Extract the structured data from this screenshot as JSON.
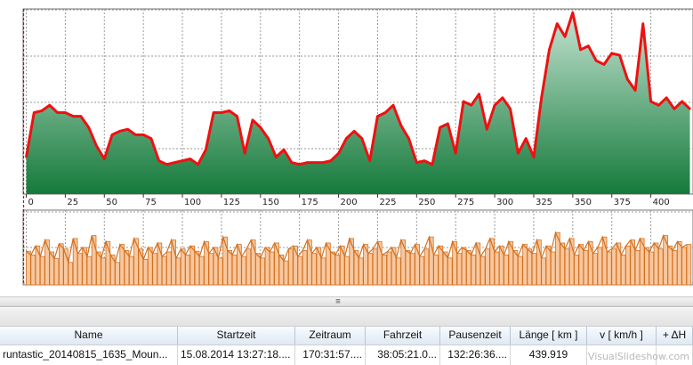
{
  "chart_data": [
    {
      "type": "area",
      "title": "",
      "xlabel": "",
      "ylabel": "",
      "xlim": [
        -2,
        427
      ],
      "ylim": [
        0,
        100
      ],
      "grid": true,
      "tick_labels": [
        "0",
        "25",
        "50",
        "75",
        "100",
        "125",
        "150",
        "175",
        "200",
        "225",
        "250",
        "275",
        "300",
        "325",
        "350",
        "375",
        "400"
      ],
      "x": [
        0,
        5,
        10,
        15,
        20,
        25,
        30,
        35,
        40,
        45,
        50,
        55,
        60,
        65,
        70,
        75,
        80,
        85,
        90,
        95,
        100,
        105,
        110,
        115,
        120,
        125,
        130,
        135,
        140,
        145,
        150,
        155,
        160,
        165,
        170,
        175,
        180,
        185,
        190,
        195,
        200,
        205,
        210,
        215,
        220,
        225,
        230,
        235,
        240,
        245,
        250,
        255,
        260,
        265,
        270,
        275,
        280,
        285,
        290,
        295,
        300,
        305,
        310,
        315,
        320,
        325,
        330,
        335,
        340,
        345,
        350,
        355,
        360,
        365,
        370,
        375,
        380,
        385,
        390,
        395,
        400,
        405,
        410,
        415,
        420,
        425
      ],
      "values": [
        20,
        44,
        45,
        48,
        44,
        44,
        42,
        42,
        36,
        26,
        19,
        32,
        34,
        35,
        32,
        32,
        30,
        18,
        16,
        17,
        18,
        19,
        16,
        24,
        44,
        44,
        45,
        42,
        22,
        40,
        36,
        30,
        20,
        24,
        17,
        16,
        17,
        17,
        17,
        18,
        22,
        30,
        34,
        30,
        18,
        42,
        44,
        48,
        37,
        30,
        17,
        18,
        16,
        36,
        38,
        22,
        50,
        48,
        54,
        35,
        48,
        52,
        46,
        22,
        30,
        20,
        52,
        78,
        92,
        85,
        98,
        78,
        80,
        72,
        70,
        76,
        75,
        62,
        56,
        92,
        50,
        48,
        52,
        46,
        50,
        46
      ]
    },
    {
      "type": "bar",
      "title": "",
      "xlabel": "",
      "ylabel": "",
      "xlim": [
        -2,
        427
      ],
      "ylim": [
        0,
        100
      ],
      "grid": true,
      "x": [
        0,
        3,
        6,
        9,
        12,
        15,
        18,
        21,
        24,
        27,
        30,
        33,
        36,
        39,
        42,
        45,
        48,
        51,
        54,
        57,
        60,
        63,
        66,
        69,
        72,
        75,
        78,
        81,
        84,
        87,
        90,
        93,
        96,
        99,
        102,
        105,
        108,
        111,
        114,
        117,
        120,
        123,
        126,
        129,
        132,
        135,
        138,
        141,
        144,
        147,
        150,
        153,
        156,
        159,
        162,
        165,
        168,
        171,
        174,
        177,
        180,
        183,
        186,
        189,
        192,
        195,
        198,
        201,
        204,
        207,
        210,
        213,
        216,
        219,
        222,
        225,
        228,
        231,
        234,
        237,
        240,
        243,
        246,
        249,
        252,
        255,
        258,
        261,
        264,
        267,
        270,
        273,
        276,
        279,
        282,
        285,
        288,
        291,
        294,
        297,
        300,
        303,
        306,
        309,
        312,
        315,
        318,
        321,
        324,
        327,
        330,
        333,
        336,
        339,
        342,
        345,
        348,
        351,
        354,
        357,
        360,
        363,
        366,
        369,
        372,
        375,
        378,
        381,
        384,
        387,
        390,
        393,
        396,
        399,
        402,
        405,
        408,
        411,
        414,
        417,
        420,
        423
      ],
      "values": [
        45,
        40,
        52,
        38,
        60,
        44,
        35,
        55,
        48,
        30,
        62,
        42,
        50,
        38,
        66,
        44,
        36,
        58,
        40,
        30,
        54,
        46,
        38,
        62,
        48,
        34,
        50,
        42,
        56,
        38,
        44,
        60,
        36,
        48,
        40,
        52,
        45,
        38,
        58,
        42,
        50,
        36,
        64,
        46,
        40,
        54,
        38,
        48,
        60,
        42,
        36,
        50,
        44,
        56,
        40,
        32,
        48,
        52,
        38,
        46,
        60,
        42,
        50,
        36,
        56,
        44,
        40,
        52,
        38,
        62,
        46,
        36,
        54,
        42,
        48,
        58,
        40,
        44,
        50,
        36,
        60,
        46,
        42,
        54,
        38,
        48,
        64,
        40,
        52,
        44,
        36,
        58,
        42,
        50,
        46,
        40,
        56,
        38,
        48,
        62,
        44,
        52,
        40,
        58,
        46,
        38,
        54,
        48,
        42,
        60,
        36,
        52,
        44,
        70,
        56,
        48,
        62,
        40,
        54,
        46,
        58,
        42,
        50,
        64,
        44,
        48,
        56,
        40,
        52,
        60,
        46,
        62,
        50,
        44,
        56,
        48,
        66,
        52,
        46,
        58,
        50,
        54
      ]
    }
  ],
  "splitter": {
    "grip": "≡"
  },
  "table": {
    "columns": [
      "Name",
      "Startzeit",
      "Zeitraum",
      "Fahrzeit",
      "Pausenzeit",
      "Länge  [ km ]",
      "v  [ km/h ]",
      "+ ΔH"
    ],
    "row": [
      "runtastic_20140815_1635_Moun...",
      "15.08.2014 13:27:18....",
      "170:31:57....",
      "38:05:21.0...",
      "132:26:36....",
      "439.919",
      "",
      ""
    ]
  },
  "watermark": "VisualSlideshow.com",
  "colors": {
    "elevation_line": "#ee1111",
    "elevation_fill_top": "#c4e3d2",
    "elevation_fill_bottom": "#157a3a",
    "speed_line": "#d2701f",
    "speed_fill": "#f8c79e",
    "marker_line": "#cc0000",
    "grid": "#9a9a9a"
  }
}
